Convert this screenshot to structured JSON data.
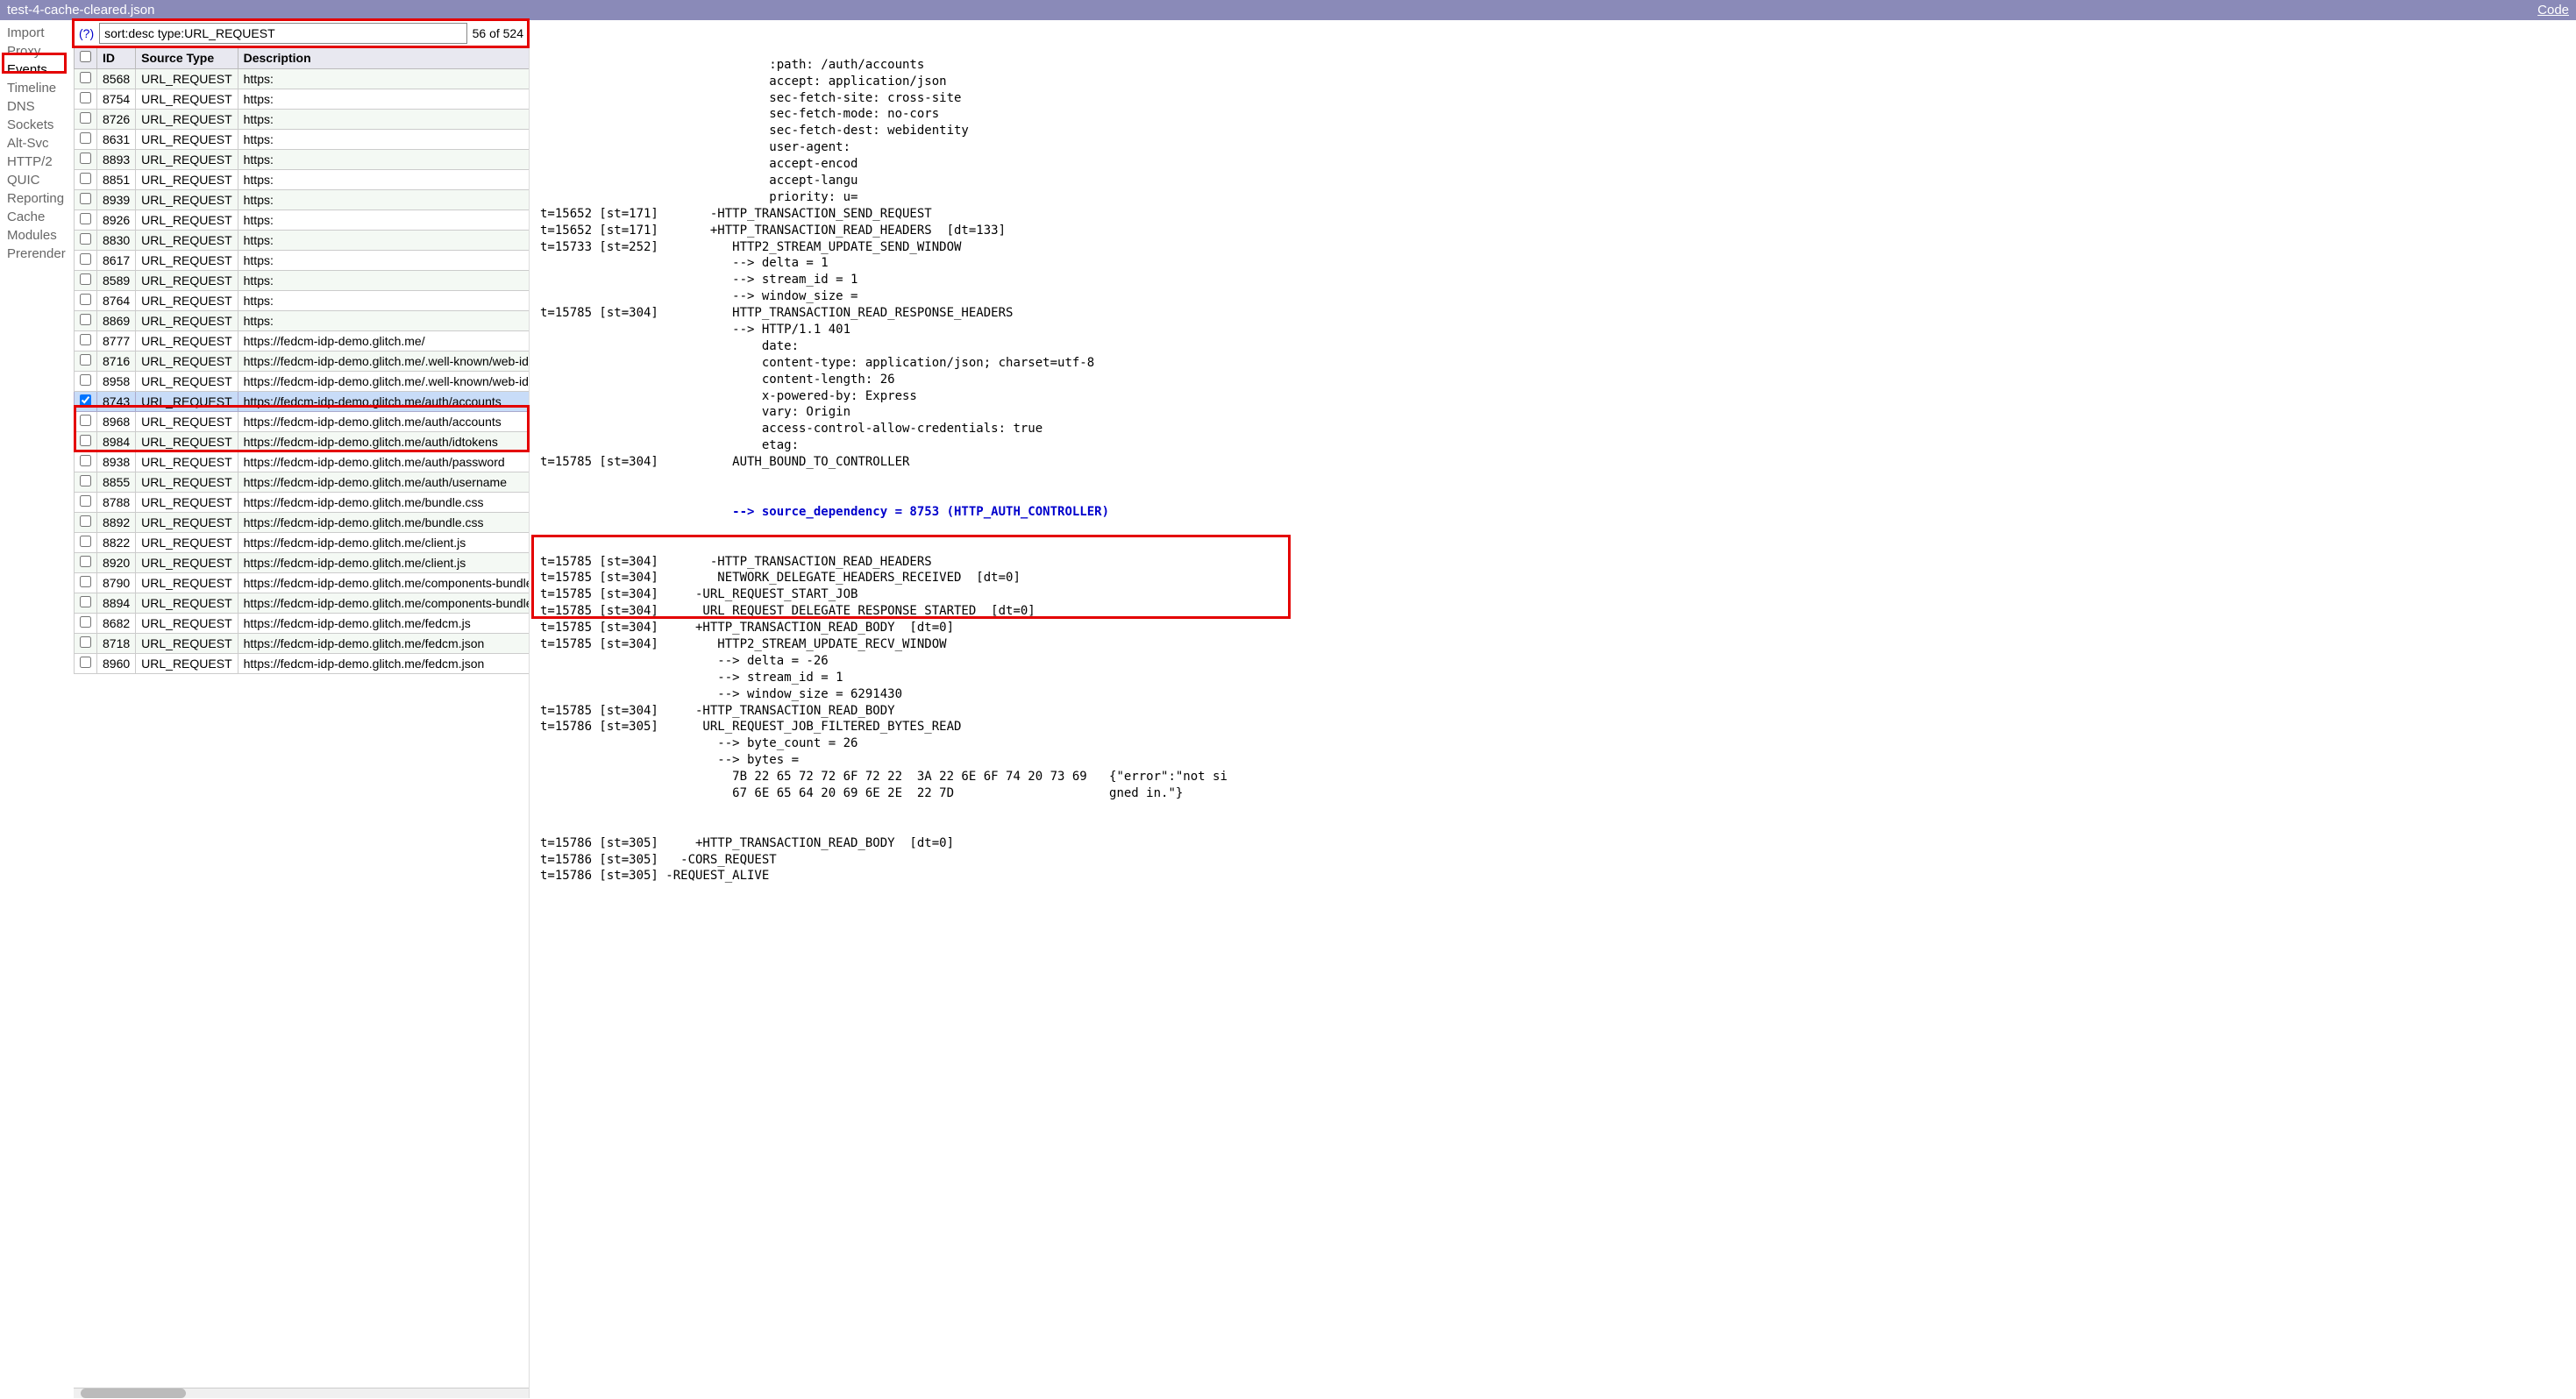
{
  "titlebar": {
    "filename": "test-4-cache-cleared.json",
    "code_link": "Code"
  },
  "sidebar": {
    "items": [
      {
        "label": "Import"
      },
      {
        "label": "Proxy"
      },
      {
        "label": "Events",
        "active": true
      },
      {
        "label": "Timeline"
      },
      {
        "label": "DNS"
      },
      {
        "label": "Sockets"
      },
      {
        "label": "Alt-Svc"
      },
      {
        "label": "HTTP/2"
      },
      {
        "label": "QUIC"
      },
      {
        "label": "Reporting"
      },
      {
        "label": "Cache"
      },
      {
        "label": "Modules"
      },
      {
        "label": "Prerender"
      }
    ]
  },
  "filter": {
    "help": "(?)",
    "value": "sort:desc type:URL_REQUEST",
    "count": "56 of 524"
  },
  "table": {
    "headers": {
      "chk": "",
      "id": "ID",
      "type": "Source Type",
      "desc": "Description"
    },
    "rows": [
      {
        "id": "8568",
        "type": "URL_REQUEST",
        "desc": "https:"
      },
      {
        "id": "8754",
        "type": "URL_REQUEST",
        "desc": "https:"
      },
      {
        "id": "8726",
        "type": "URL_REQUEST",
        "desc": "https:"
      },
      {
        "id": "8631",
        "type": "URL_REQUEST",
        "desc": "https:"
      },
      {
        "id": "8893",
        "type": "URL_REQUEST",
        "desc": "https:"
      },
      {
        "id": "8851",
        "type": "URL_REQUEST",
        "desc": "https:"
      },
      {
        "id": "8939",
        "type": "URL_REQUEST",
        "desc": "https:"
      },
      {
        "id": "8926",
        "type": "URL_REQUEST",
        "desc": "https:"
      },
      {
        "id": "8830",
        "type": "URL_REQUEST",
        "desc": "https:"
      },
      {
        "id": "8617",
        "type": "URL_REQUEST",
        "desc": "https:"
      },
      {
        "id": "8589",
        "type": "URL_REQUEST",
        "desc": "https:"
      },
      {
        "id": "8764",
        "type": "URL_REQUEST",
        "desc": "https:"
      },
      {
        "id": "8869",
        "type": "URL_REQUEST",
        "desc": "https:"
      },
      {
        "id": "8777",
        "type": "URL_REQUEST",
        "desc": "https://fedcm-idp-demo.glitch.me/"
      },
      {
        "id": "8716",
        "type": "URL_REQUEST",
        "desc": "https://fedcm-idp-demo.glitch.me/.well-known/web-iden"
      },
      {
        "id": "8958",
        "type": "URL_REQUEST",
        "desc": "https://fedcm-idp-demo.glitch.me/.well-known/web-iden"
      },
      {
        "id": "8743",
        "type": "URL_REQUEST",
        "desc": "https://fedcm-idp-demo.glitch.me/auth/accounts",
        "selected": true,
        "checked": true
      },
      {
        "id": "8968",
        "type": "URL_REQUEST",
        "desc": "https://fedcm-idp-demo.glitch.me/auth/accounts"
      },
      {
        "id": "8984",
        "type": "URL_REQUEST",
        "desc": "https://fedcm-idp-demo.glitch.me/auth/idtokens"
      },
      {
        "id": "8938",
        "type": "URL_REQUEST",
        "desc": "https://fedcm-idp-demo.glitch.me/auth/password"
      },
      {
        "id": "8855",
        "type": "URL_REQUEST",
        "desc": "https://fedcm-idp-demo.glitch.me/auth/username"
      },
      {
        "id": "8788",
        "type": "URL_REQUEST",
        "desc": "https://fedcm-idp-demo.glitch.me/bundle.css"
      },
      {
        "id": "8892",
        "type": "URL_REQUEST",
        "desc": "https://fedcm-idp-demo.glitch.me/bundle.css"
      },
      {
        "id": "8822",
        "type": "URL_REQUEST",
        "desc": "https://fedcm-idp-demo.glitch.me/client.js"
      },
      {
        "id": "8920",
        "type": "URL_REQUEST",
        "desc": "https://fedcm-idp-demo.glitch.me/client.js"
      },
      {
        "id": "8790",
        "type": "URL_REQUEST",
        "desc": "https://fedcm-idp-demo.glitch.me/components-bundle.j"
      },
      {
        "id": "8894",
        "type": "URL_REQUEST",
        "desc": "https://fedcm-idp-demo.glitch.me/components-bundle.j"
      },
      {
        "id": "8682",
        "type": "URL_REQUEST",
        "desc": "https://fedcm-idp-demo.glitch.me/fedcm.js"
      },
      {
        "id": "8718",
        "type": "URL_REQUEST",
        "desc": "https://fedcm-idp-demo.glitch.me/fedcm.json"
      },
      {
        "id": "8960",
        "type": "URL_REQUEST",
        "desc": "https://fedcm-idp-demo.glitch.me/fedcm.json"
      }
    ]
  },
  "details": {
    "lines_pre": [
      "                               :path: /auth/accounts",
      "                               accept: application/json",
      "                               sec-fetch-site: cross-site",
      "                               sec-fetch-mode: no-cors",
      "                               sec-fetch-dest: webidentity",
      "                               user-agent:",
      "                               accept-encod",
      "                               accept-langu",
      "                               priority: u=",
      "t=15652 [st=171]       -HTTP_TRANSACTION_SEND_REQUEST",
      "t=15652 [st=171]       +HTTP_TRANSACTION_READ_HEADERS  [dt=133]",
      "t=15733 [st=252]          HTTP2_STREAM_UPDATE_SEND_WINDOW",
      "                          --> delta = 1",
      "                          --> stream_id = 1",
      "                          --> window_size =",
      "t=15785 [st=304]          HTTP_TRANSACTION_READ_RESPONSE_HEADERS",
      "                          --> HTTP/1.1 401",
      "                              date:",
      "                              content-type: application/json; charset=utf-8",
      "                              content-length: 26",
      "                              x-powered-by: Express",
      "                              vary: Origin",
      "                              access-control-allow-credentials: true",
      "                              etag:",
      "t=15785 [st=304]          AUTH_BOUND_TO_CONTROLLER"
    ],
    "src_dep": "                          --> source_dependency = 8753 (HTTP_AUTH_CONTROLLER)",
    "lines_mid": [
      "t=15785 [st=304]       -HTTP_TRANSACTION_READ_HEADERS",
      "t=15785 [st=304]        NETWORK_DELEGATE_HEADERS_RECEIVED  [dt=0]",
      "t=15785 [st=304]     -URL_REQUEST_START_JOB",
      "t=15785 [st=304]      URL_REQUEST_DELEGATE_RESPONSE_STARTED  [dt=0]",
      "t=15785 [st=304]     +HTTP_TRANSACTION_READ_BODY  [dt=0]",
      "t=15785 [st=304]        HTTP2_STREAM_UPDATE_RECV_WINDOW",
      "                        --> delta = -26",
      "                        --> stream_id = 1",
      "                        --> window_size = 6291430",
      "t=15785 [st=304]     -HTTP_TRANSACTION_READ_BODY",
      "t=15786 [st=305]      URL_REQUEST_JOB_FILTERED_BYTES_READ",
      "                        --> byte_count = 26",
      "                        --> bytes =",
      "                          7B 22 65 72 72 6F 72 22  3A 22 6E 6F 74 20 73 69   {\"error\":\"not si",
      "                          67 6E 65 64 20 69 6E 2E  22 7D                     gned in.\"}"
    ],
    "lines_post": [
      "t=15786 [st=305]     +HTTP_TRANSACTION_READ_BODY  [dt=0]",
      "t=15786 [st=305]   -CORS_REQUEST",
      "t=15786 [st=305] -REQUEST_ALIVE"
    ]
  }
}
